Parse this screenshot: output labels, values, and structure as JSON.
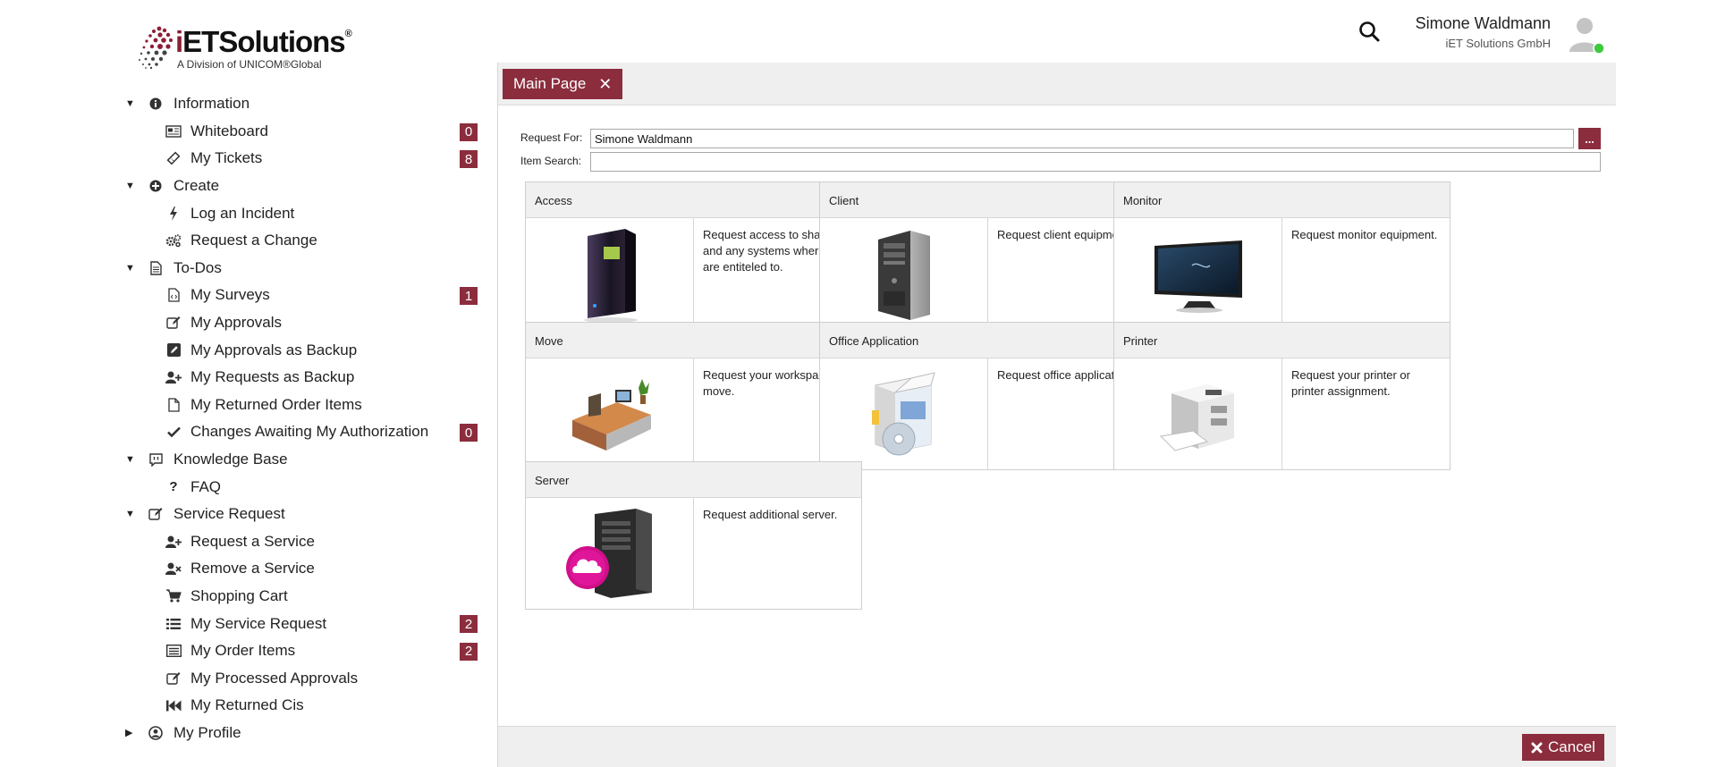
{
  "logo": {
    "brand_i": "i",
    "brand_rest": "ETSolutions",
    "reg_mark": "®",
    "tagline": "A Division of UNICOM®Global"
  },
  "header": {
    "user_name": "Simone Waldmann",
    "user_company": "iET Solutions GmbH",
    "search_icon": "magnifier-icon",
    "status_color": "#3ec93e"
  },
  "sidebar": {
    "groups": [
      {
        "label": "Information",
        "icon": "info-circle-icon",
        "expanded": true,
        "items": [
          {
            "label": "Whiteboard",
            "icon": "newspaper-icon",
            "badge": "0"
          },
          {
            "label": "My Tickets",
            "icon": "ticket-icon",
            "badge": "8"
          }
        ]
      },
      {
        "label": "Create",
        "icon": "plus-circle-icon",
        "expanded": true,
        "items": [
          {
            "label": "Log an Incident",
            "icon": "bolt-icon"
          },
          {
            "label": "Request a Change",
            "icon": "gears-icon"
          }
        ]
      },
      {
        "label": "To-Dos",
        "icon": "document-icon",
        "expanded": true,
        "items": [
          {
            "label": "My Surveys",
            "icon": "code-file-icon",
            "badge": "1"
          },
          {
            "label": "My Approvals",
            "icon": "edit-icon"
          },
          {
            "label": "My Approvals as Backup",
            "icon": "pencil-square-icon"
          },
          {
            "label": "My Requests as Backup",
            "icon": "user-plus-icon"
          },
          {
            "label": "My Returned Order Items",
            "icon": "file-icon"
          },
          {
            "label": "Changes Awaiting My Authorization",
            "icon": "check-icon",
            "badge": "0"
          }
        ]
      },
      {
        "label": "Knowledge Base",
        "icon": "comment-icon",
        "expanded": true,
        "items": [
          {
            "label": "FAQ",
            "icon": "question-icon"
          }
        ]
      },
      {
        "label": "Service Request",
        "icon": "edit-icon",
        "expanded": true,
        "items": [
          {
            "label": "Request a Service",
            "icon": "user-plus-icon"
          },
          {
            "label": "Remove a Service",
            "icon": "user-times-icon"
          },
          {
            "label": "Shopping Cart",
            "icon": "cart-icon"
          },
          {
            "label": "My Service Request",
            "icon": "list-icon",
            "badge": "2"
          },
          {
            "label": "My Order Items",
            "icon": "list-alt-icon",
            "badge": "2"
          },
          {
            "label": "My Processed Approvals",
            "icon": "edit-icon"
          },
          {
            "label": "My Returned Cis",
            "icon": "fast-backward-icon"
          }
        ]
      },
      {
        "label": "My Profile",
        "icon": "user-circle-icon",
        "expanded": false,
        "items": []
      }
    ]
  },
  "tabs": [
    {
      "label": "Main Page",
      "close": "✕"
    }
  ],
  "form": {
    "request_for_label": "Request For:",
    "request_for_value": "Simone Waldmann",
    "browse_label": "...",
    "item_search_label": "Item Search:",
    "item_search_value": ""
  },
  "catalog": [
    {
      "title": "Access",
      "desc": "Request access to shares and any systems where you are entiteled to.",
      "image": "storage-device-image"
    },
    {
      "title": "Client",
      "desc": "Request client equipment.",
      "image": "desktop-tower-image"
    },
    {
      "title": "Monitor",
      "desc": "Request monitor equipment.",
      "image": "flat-monitor-image"
    },
    {
      "title": "Move",
      "desc": "Request your workspace move.",
      "image": "office-desk-image"
    },
    {
      "title": "Office Application",
      "desc": "Request office application.",
      "image": "software-box-image"
    },
    {
      "title": "Printer",
      "desc": "Request your printer or printer assignment.",
      "image": "laser-printer-image"
    },
    {
      "title": "Server",
      "desc": "Request additional server.",
      "image": "cloud-server-image"
    }
  ],
  "footer": {
    "cancel_label": "Cancel",
    "cancel_icon": "times-icon"
  },
  "colors": {
    "accent": "#8b2d3d",
    "panel_bg": "#efefef"
  }
}
